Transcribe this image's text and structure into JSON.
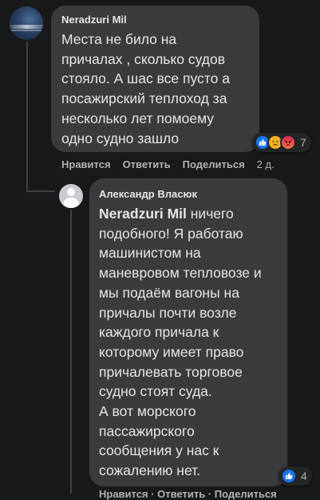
{
  "comment": {
    "author": "Neradzuri Mil",
    "text": "Места не било на\nпричалах , сколько судов\nстояло. А шас все пусто а\nпосажирский теплоход за\nнесколько лет помоему\nодно судно зашло",
    "reactions": {
      "icons": [
        "like-icon",
        "sad-icon",
        "angry-icon"
      ],
      "count": "7"
    },
    "actions": {
      "like": "Нравится",
      "reply": "Ответить",
      "share": "Поделиться",
      "time": "2 д."
    }
  },
  "reply": {
    "author": "Александр Власюк",
    "mention": "Neradzuri Mil",
    "text": " ничего\nподобного! Я работаю\nмашинистом на\nманевровом тепловозе и\nмы подаём вагоны на\nпричалы почти возле\nкаждого причала к\nкоторому имеет право\nпричалевать торговое\nсудно стоят суда.\nА вот морского\nпассажирского\nсообщения у нас к\nсожалению нет.",
    "reactions": {
      "icons": [
        "like-icon"
      ],
      "count": "4"
    },
    "actions_partial": "Нравится · Ответить · Поделиться"
  },
  "colors": {
    "background": "#18191a",
    "bubble": "#3a3b3c",
    "text": "#e4e6eb",
    "secondary_text": "#b0b3b8",
    "like_blue": "#1877f2"
  }
}
